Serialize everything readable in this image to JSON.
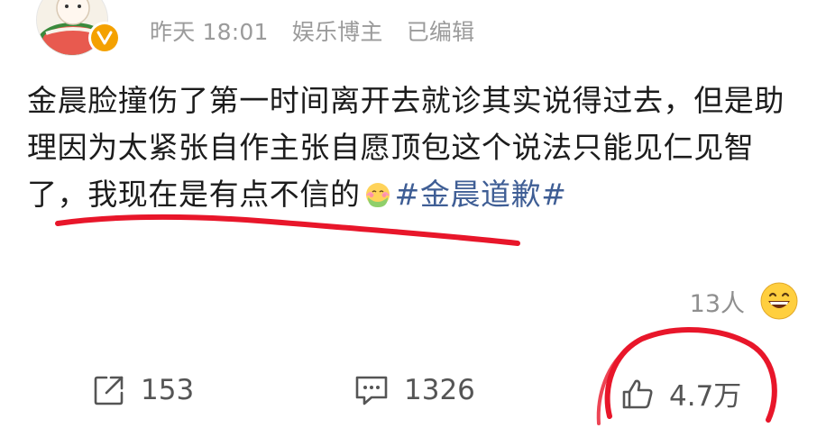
{
  "post": {
    "time": "昨天 18:01",
    "source": "娱乐博主",
    "edited": "已编辑",
    "text_part1": "金晨脸撞伤了第一时间离开去就诊其实说得过去，但是助理因为太紧张自作主张自愿顶包这个说法只能见仁见智了，我现在是有点不信的",
    "hashtag": "#金晨道歉#"
  },
  "reactions": {
    "count": "13人"
  },
  "actions": {
    "share_count": "153",
    "comment_count": "1326",
    "like_count": "4.7万"
  },
  "colors": {
    "hashtag": "#3f5e95",
    "meta": "#9b9b9b",
    "pen_mark": "#e8162a",
    "verified": "#f4a100"
  },
  "icons": {
    "share": "share-icon",
    "comment": "comment-icon",
    "like": "thumbs-up-icon",
    "reaction": "grinning-face-icon",
    "inline_emoji": "shy-face-icon"
  }
}
